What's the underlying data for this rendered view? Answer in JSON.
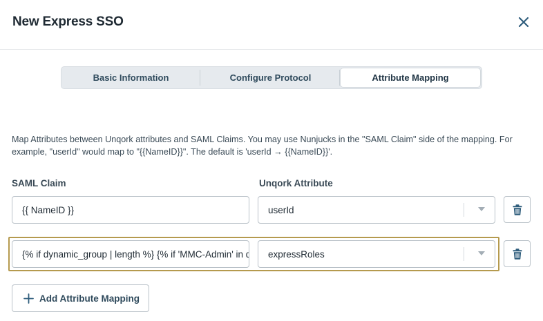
{
  "dialog": {
    "title": "New Express SSO",
    "close_icon": "close-icon"
  },
  "tabs": [
    {
      "label": "Basic Information",
      "active": false
    },
    {
      "label": "Configure Protocol",
      "active": false
    },
    {
      "label": "Attribute Mapping",
      "active": true
    }
  ],
  "description": "Map Attributes between Unqork attributes and SAML Claims. You may use Nunjucks in the \"SAML Claim\" side of the mapping. For example, \"userId\" would map to \"{{NameID}}\". The default is 'userId → {{NameID}}'.",
  "columns": {
    "saml_claim": "SAML Claim",
    "unqork_attribute": "Unqork Attribute"
  },
  "mappings": [
    {
      "saml_claim": "{{ NameID }}",
      "unqork_attribute": "userId"
    },
    {
      "saml_claim": "{% if dynamic_group | length %} {% if 'MMC-Admin' in dynamic_group %}",
      "unqork_attribute": "expressRoles"
    }
  ],
  "add_button": {
    "label": "Add Attribute Mapping",
    "icon": "plus-icon"
  },
  "colors": {
    "accent": "#2f5d7c",
    "highlight_border": "#b59a4e",
    "tab_bg": "#e6eaee"
  }
}
